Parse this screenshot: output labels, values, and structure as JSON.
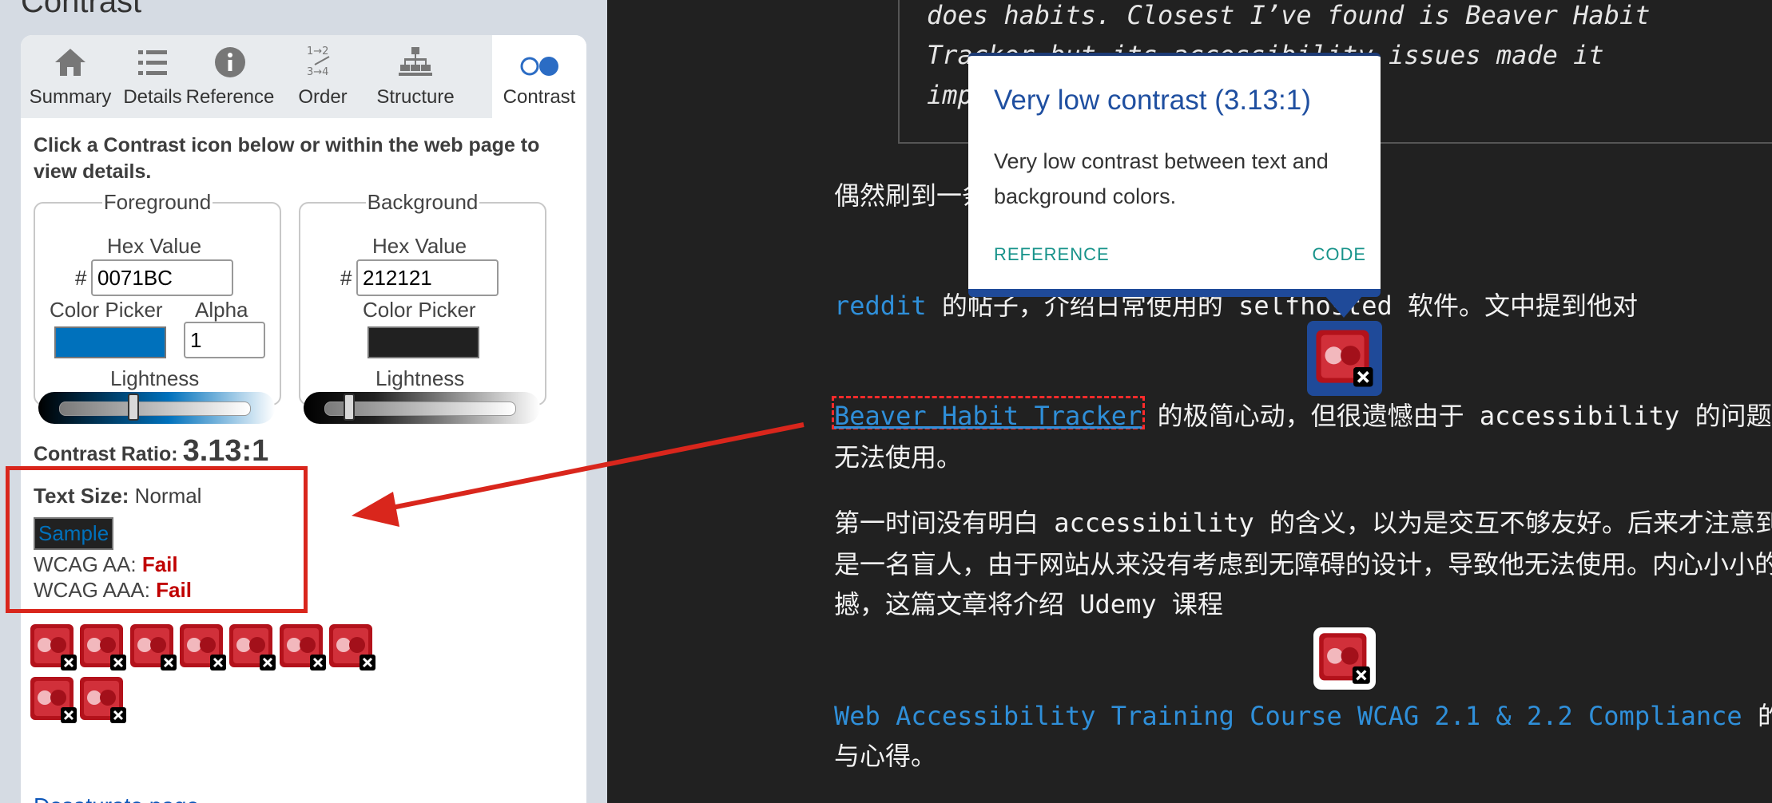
{
  "panel": {
    "title": "Contrast",
    "tabs": [
      {
        "label": "Summary",
        "icon": "home-icon"
      },
      {
        "label": "Details",
        "icon": "list-icon"
      },
      {
        "label": "Reference",
        "icon": "info-icon"
      },
      {
        "label": "Order",
        "icon": "order-icon"
      },
      {
        "label": "Structure",
        "icon": "structure-icon"
      },
      {
        "label": "Contrast",
        "icon": "contrast-icon",
        "active": true
      }
    ],
    "instruction": "Click a Contrast icon below or within the web page to view details.",
    "foreground": {
      "legend": "Foreground",
      "hex_label": "Hex Value",
      "hash": "#",
      "hex_value": "0071BC",
      "picker_label": "Color Picker",
      "alpha_label": "Alpha",
      "alpha_value": "1",
      "lightness_label": "Lightness",
      "lightness_level": 0.39,
      "color": "#0071BC"
    },
    "background": {
      "legend": "Background",
      "hex_label": "Hex Value",
      "hash": "#",
      "hex_value": "212121",
      "picker_label": "Color Picker",
      "lightness_label": "Lightness",
      "lightness_level": 0.13,
      "color": "#212121"
    },
    "contrast_ratio_label": "Contrast Ratio:",
    "contrast_ratio_value": "3.13:1",
    "text_size_label": "Text Size:",
    "text_size_value": "Normal",
    "sample_label": "Sample",
    "wcag_aa_label": "WCAG AA:",
    "wcag_aa_result": "Fail",
    "wcag_aaa_label": "WCAG AAA:",
    "wcag_aaa_result": "Fail",
    "contrast_icon_count": 9,
    "desaturate_link": "Desaturate page"
  },
  "content": {
    "quote_lines": [
      "does habits. Closest I’ve found is Beaver Habit",
      "Tracker but its accessibility issues made it",
      "imp"
    ],
    "para1": "偶然刷到一条",
    "para2_link": "reddit",
    "para2_text": " 的帖子，介绍日常使用的 selfhosted 软件。文中提到他对",
    "para3_link": "Beaver Habit Tracker",
    "para3_text": " 的极简心动，但很遗憾由于 accessibility 的问题",
    "para3_line2": "无法使用。",
    "para4_lines": [
      "第一时间没有明白 accessibility 的含义，以为是交互不够友好。后来才注意到",
      "是一名盲人，由于网站从来没有考虑到无障碍的设计，导致他无法使用。内心小小的",
      "撼，这篇文章将介绍 Udemy 课程"
    ],
    "para5_link": "Web Accessibility Training Course WCAG 2.1 & 2.2 Compliance",
    "para5_tail": " 的",
    "para5_line2": "与心得。"
  },
  "popup": {
    "title": "Very low contrast (3.13:1)",
    "description": "Very low contrast between text and background colors.",
    "reference_link": "REFERENCE",
    "code_link": "CODE"
  },
  "colors": {
    "accent_blue": "#0071BC",
    "fail_red": "#C00000",
    "annotation_red": "#D9261C",
    "popup_title": "#1F4FA0"
  }
}
